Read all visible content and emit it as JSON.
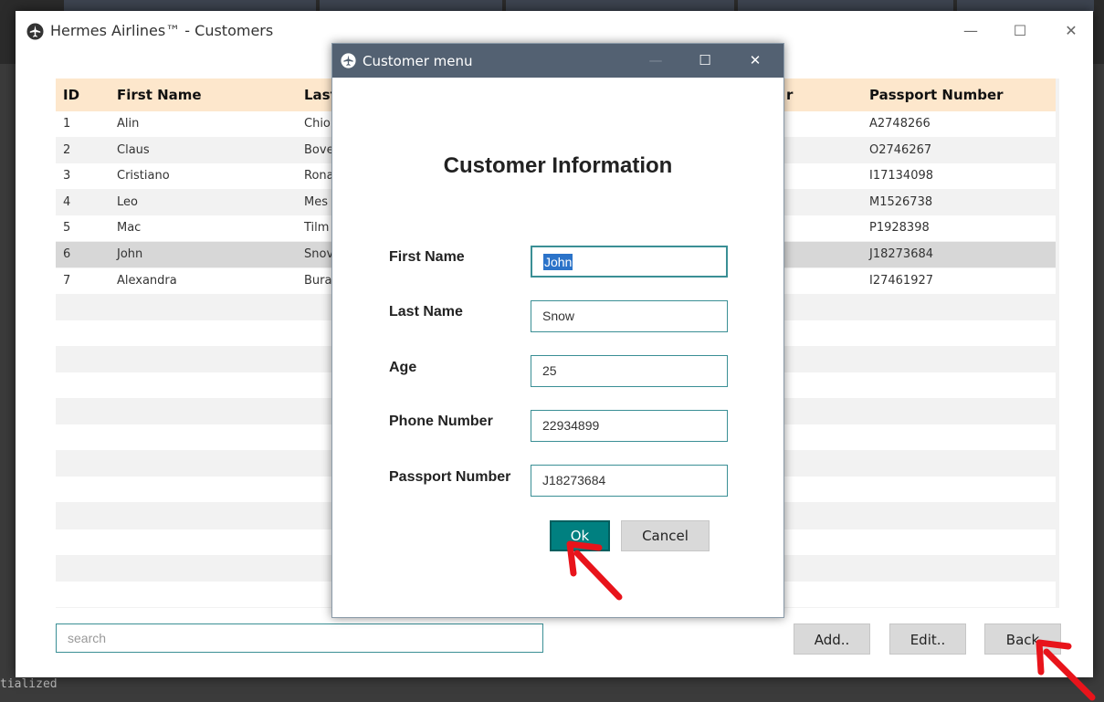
{
  "window": {
    "title": "Hermes Airlines™  -  Customers"
  },
  "table": {
    "columns": [
      "ID",
      "First Name",
      "Last",
      "r",
      "Passport Number"
    ],
    "rows": [
      {
        "id": "1",
        "first": "Alin",
        "last": "Chio",
        "passport": "A2748266"
      },
      {
        "id": "2",
        "first": "Claus",
        "last": "Bove",
        "passport": "O2746267"
      },
      {
        "id": "3",
        "first": "Cristiano",
        "last": "Rona",
        "passport": "I17134098"
      },
      {
        "id": "4",
        "first": "Leo",
        "last": "Mes",
        "passport": "M1526738"
      },
      {
        "id": "5",
        "first": "Mac",
        "last": "Tilm",
        "passport": "P1928398"
      },
      {
        "id": "6",
        "first": "John",
        "last": "Snov",
        "passport": "J18273684"
      },
      {
        "id": "7",
        "first": "Alexandra",
        "last": "Bura",
        "passport": "I27461927"
      }
    ],
    "selected_row": 6
  },
  "search": {
    "placeholder": "search"
  },
  "buttons": {
    "add": "Add..",
    "edit": "Edit..",
    "back": "Back"
  },
  "dialog": {
    "title": "Customer menu",
    "heading": "Customer Information",
    "fields": [
      {
        "label": "First Name",
        "value": "John"
      },
      {
        "label": "Last Name",
        "value": "Snow"
      },
      {
        "label": "Age",
        "value": "25"
      },
      {
        "label": "Phone Number",
        "value": "22934899"
      },
      {
        "label": "Passport Number",
        "value": "J18273684"
      }
    ],
    "ok": "Ok",
    "cancel": "Cancel"
  },
  "background": {
    "console_text": "tialized"
  },
  "colors": {
    "accent": "#008080",
    "header": "#fde7cc",
    "dialog_titlebar": "#536172",
    "arrow": "#e8141b"
  }
}
